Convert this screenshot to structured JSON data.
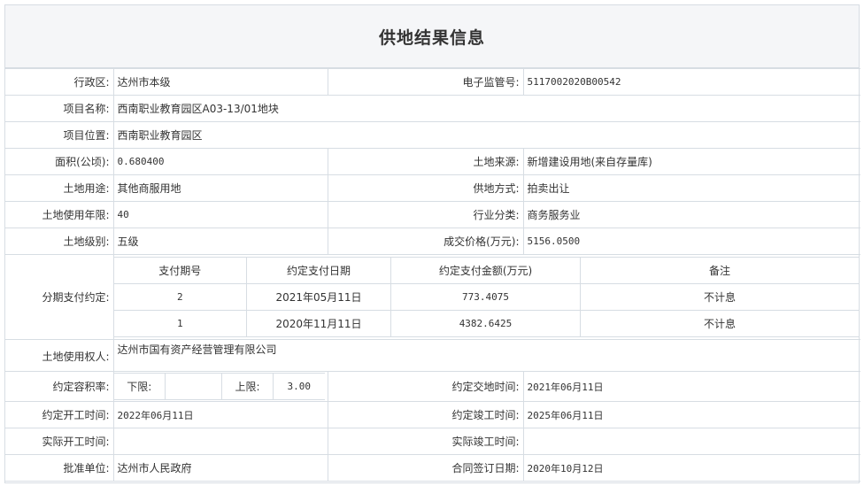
{
  "title": "供地结果信息",
  "fields": {
    "district_label": "行政区:",
    "district": "达州市本级",
    "supervision_no_label": "电子监管号:",
    "supervision_no": "5117002020B00542",
    "project_name_label": "项目名称:",
    "project_name": "西南职业教育园区A03-13/01地块",
    "project_location_label": "项目位置:",
    "project_location": "西南职业教育园区",
    "area_label": "面积(公顷):",
    "area": "0.680400",
    "land_source_label": "土地来源:",
    "land_source": "新增建设用地(来自存量库)",
    "land_use_label": "土地用途:",
    "land_use": "其他商服用地",
    "supply_method_label": "供地方式:",
    "supply_method": "拍卖出让",
    "use_years_label": "土地使用年限:",
    "use_years": "40",
    "industry_label": "行业分类:",
    "industry": "商务服务业",
    "land_grade_label": "土地级别:",
    "land_grade": "五级",
    "deal_price_label": "成交价格(万元):",
    "deal_price": "5156.0500",
    "installments_label": "分期支付约定:",
    "owner_label": "土地使用权人:",
    "owner": "达州市国有资产经营管理有限公司",
    "far_label": "约定容积率:",
    "far_lower_label": "下限:",
    "far_lower": "",
    "far_upper_label": "上限:",
    "far_upper": "3.00",
    "handover_label": "约定交地时间:",
    "handover": "2021年06月11日",
    "start_label": "约定开工时间:",
    "start": "2022年06月11日",
    "completion_label": "约定竣工时间:",
    "completion": "2025年06月11日",
    "actual_start_label": "实际开工时间:",
    "actual_start": "",
    "actual_completion_label": "实际竣工时间:",
    "actual_completion": "",
    "approver_label": "批准单位:",
    "approver": "达州市人民政府",
    "contract_date_label": "合同签订日期:",
    "contract_date": "2020年10月12日"
  },
  "payments": {
    "headers": [
      "支付期号",
      "约定支付日期",
      "约定支付金额(万元)",
      "备注"
    ],
    "rows": [
      [
        "2",
        "2021年05月11日",
        "773.4075",
        "不计息"
      ],
      [
        "1",
        "2020年11月11日",
        "4382.6425",
        "不计息"
      ]
    ]
  },
  "colors": {
    "border": "#d7dde3",
    "title_bg": "#f5f6f8",
    "text": "#333333"
  }
}
